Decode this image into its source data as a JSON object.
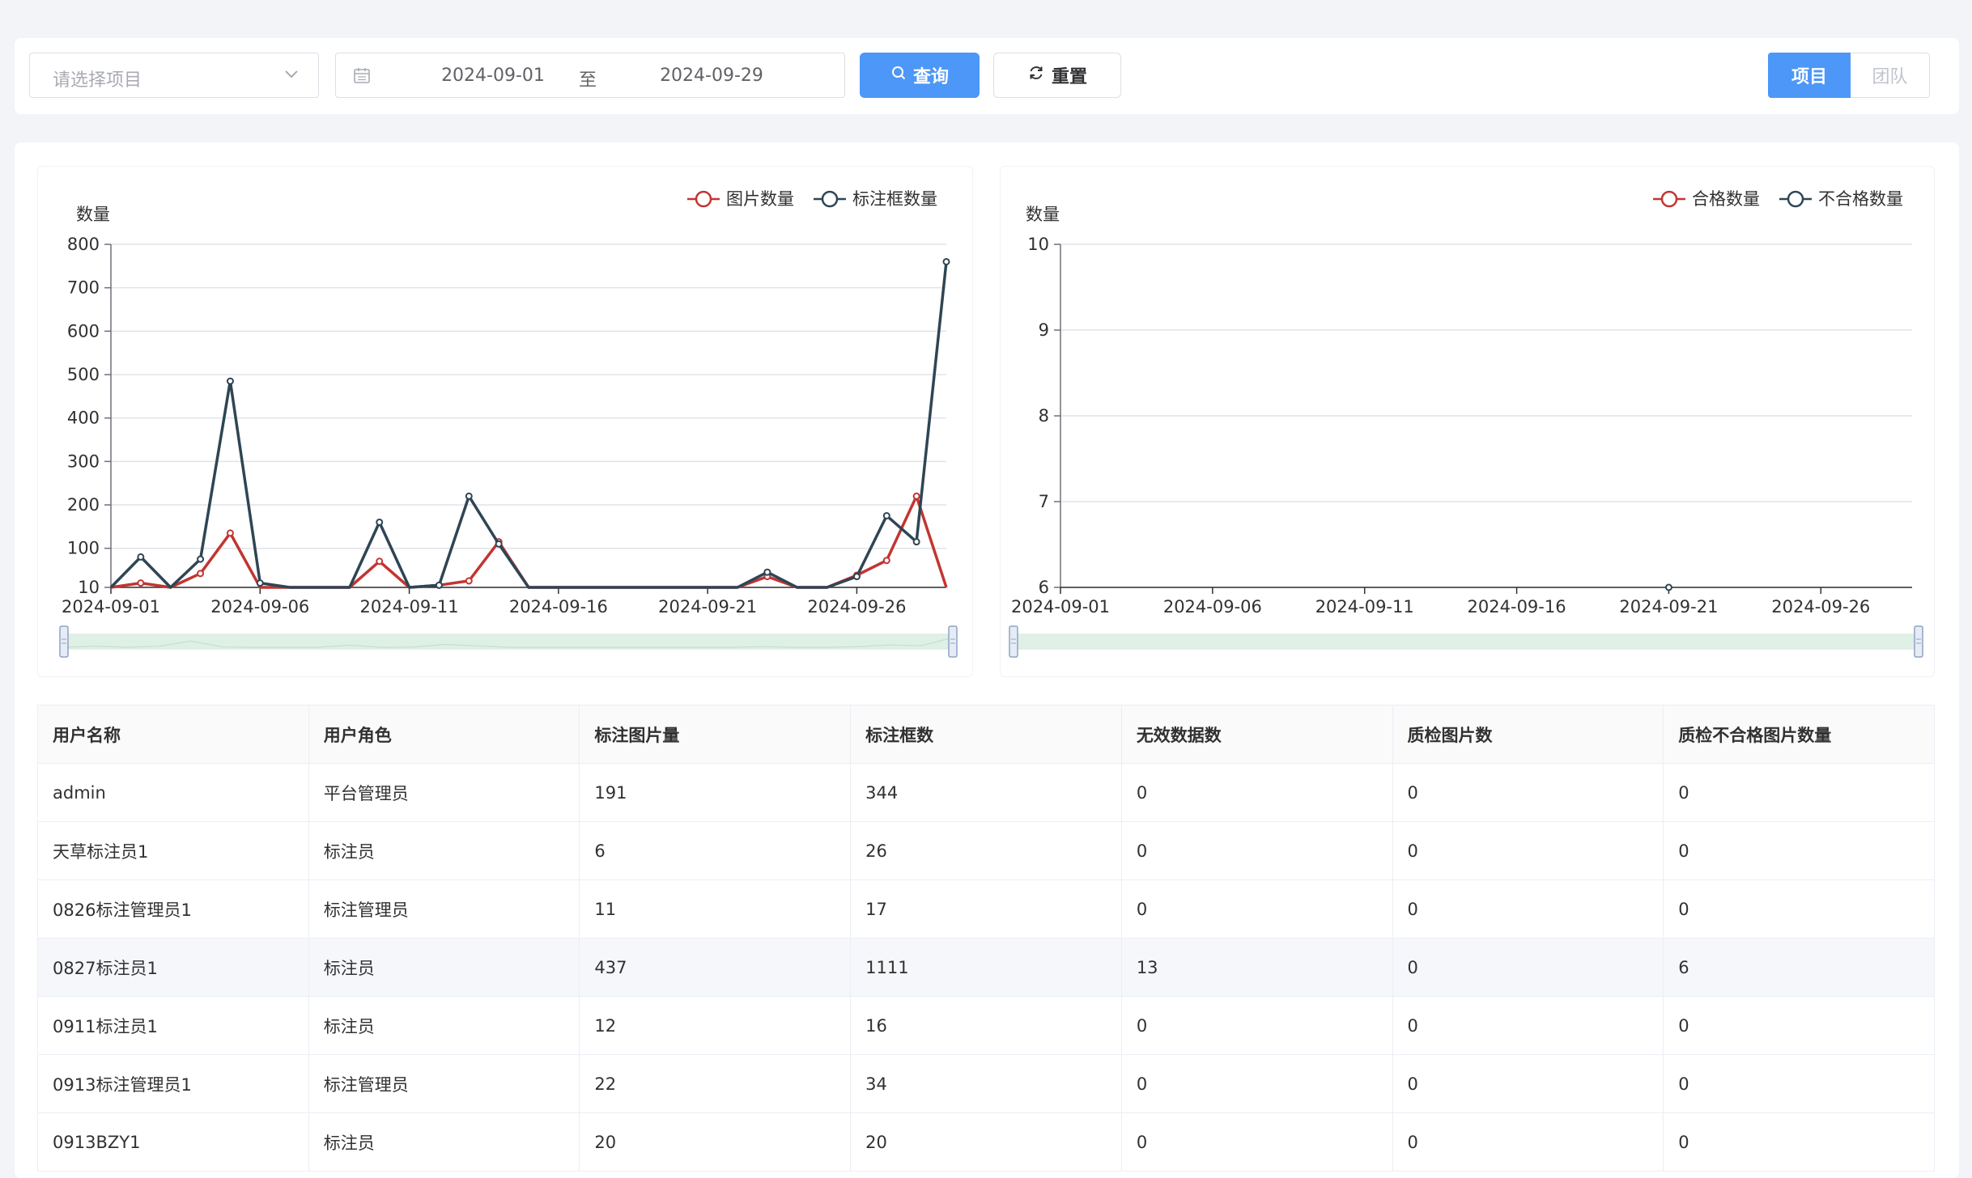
{
  "filters": {
    "project_placeholder": "请选择项目",
    "date_start": "2024-09-01",
    "date_separator": "至",
    "date_end": "2024-09-29",
    "query_label": "查询",
    "reset_label": "重置",
    "mode_project": "项目",
    "mode_team": "团队"
  },
  "colors": {
    "primary": "#4c97f7",
    "series_red": "#c23531",
    "series_dark": "#2f4554",
    "zoom_fill": "#d5efe0"
  },
  "icons": {
    "select_chevron": "chevron-down-icon",
    "date": "calendar-icon",
    "query": "search-icon",
    "reset": "refresh-icon"
  },
  "chart_data": [
    {
      "type": "line",
      "ylabel": "数量",
      "x": [
        "2024-09-01",
        "2024-09-02",
        "2024-09-03",
        "2024-09-04",
        "2024-09-05",
        "2024-09-06",
        "2024-09-07",
        "2024-09-08",
        "2024-09-09",
        "2024-09-10",
        "2024-09-11",
        "2024-09-12",
        "2024-09-13",
        "2024-09-14",
        "2024-09-15",
        "2024-09-16",
        "2024-09-17",
        "2024-09-18",
        "2024-09-19",
        "2024-09-20",
        "2024-09-21",
        "2024-09-22",
        "2024-09-23",
        "2024-09-24",
        "2024-09-25",
        "2024-09-26",
        "2024-09-27",
        "2024-09-28",
        "2024-09-29"
      ],
      "xticks": [
        "2024-09-01",
        "2024-09-06",
        "2024-09-11",
        "2024-09-16",
        "2024-09-21",
        "2024-09-26"
      ],
      "yticks": [
        10,
        100,
        200,
        300,
        400,
        500,
        600,
        700,
        800
      ],
      "ylim": [
        10,
        800
      ],
      "series": [
        {
          "name": "图片数量",
          "color": "#c23531",
          "values": [
            0,
            20,
            0,
            42,
            135,
            0,
            0,
            0,
            0,
            70,
            0,
            15,
            25,
            115,
            0,
            0,
            0,
            0,
            0,
            0,
            0,
            0,
            35,
            0,
            0,
            38,
            72,
            220,
            0
          ]
        },
        {
          "name": "标注框数量",
          "color": "#2f4554",
          "values": [
            0,
            80,
            0,
            75,
            485,
            20,
            0,
            0,
            0,
            160,
            0,
            15,
            220,
            110,
            0,
            0,
            0,
            0,
            0,
            0,
            0,
            0,
            45,
            0,
            0,
            35,
            175,
            115,
            760
          ]
        }
      ],
      "legend_position": "top-right",
      "grid": true
    },
    {
      "type": "line",
      "ylabel": "数量",
      "x": [
        "2024-09-01",
        "2024-09-06",
        "2024-09-11",
        "2024-09-16",
        "2024-09-21",
        "2024-09-26"
      ],
      "xticks": [
        "2024-09-01",
        "2024-09-06",
        "2024-09-11",
        "2024-09-16",
        "2024-09-21",
        "2024-09-26"
      ],
      "yticks": [
        6,
        7,
        8,
        9,
        10
      ],
      "ylim": [
        6,
        10
      ],
      "series": [
        {
          "name": "合格数量",
          "color": "#c23531",
          "values": []
        },
        {
          "name": "不合格数量",
          "color": "#2f4554",
          "values": []
        }
      ],
      "legend_position": "top-right",
      "grid": true
    }
  ],
  "table": {
    "headers": [
      "用户名称",
      "用户角色",
      "标注图片量",
      "标注框数",
      "无效数据数",
      "质检图片数",
      "质检不合格图片数量"
    ],
    "rows": [
      [
        "admin",
        "平台管理员",
        "191",
        "344",
        "0",
        "0",
        "0"
      ],
      [
        "天草标注员1",
        "标注员",
        "6",
        "26",
        "0",
        "0",
        "0"
      ],
      [
        "0826标注管理员1",
        "标注管理员",
        "11",
        "17",
        "0",
        "0",
        "0"
      ],
      [
        "0827标注员1",
        "标注员",
        "437",
        "1111",
        "13",
        "0",
        "6"
      ],
      [
        "0911标注员1",
        "标注员",
        "12",
        "16",
        "0",
        "0",
        "0"
      ],
      [
        "0913标注管理员1",
        "标注管理员",
        "22",
        "34",
        "0",
        "0",
        "0"
      ],
      [
        "0913BZY1",
        "标注员",
        "20",
        "20",
        "0",
        "0",
        "0"
      ]
    ]
  }
}
